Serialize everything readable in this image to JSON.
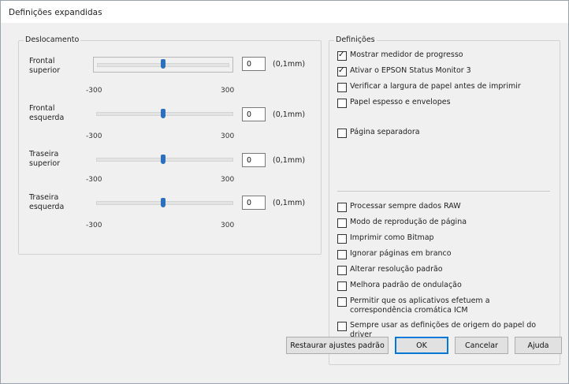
{
  "window": {
    "title": "Definições expandidas"
  },
  "offset": {
    "title": "Deslocamento",
    "unit": "(0,1mm)",
    "range_min": "-300",
    "range_max": "300",
    "sliders": [
      {
        "label": "Frontal superior",
        "value": "0",
        "slider_value": 0
      },
      {
        "label": "Frontal esquerda",
        "value": "0",
        "slider_value": 0
      },
      {
        "label": "Traseira superior",
        "value": "0",
        "slider_value": 0
      },
      {
        "label": "Traseira esquerda",
        "value": "0",
        "slider_value": 0
      }
    ]
  },
  "settings": {
    "title": "Definições",
    "options": [
      {
        "label": "Mostrar medidor de progresso",
        "checked": true
      },
      {
        "label": "Ativar o EPSON Status Monitor 3",
        "checked": true
      },
      {
        "label": "Verificar a largura de papel antes de imprimir",
        "checked": false
      },
      {
        "label": "Papel espesso e envelopes",
        "checked": false
      },
      {
        "label": "Página separadora",
        "checked": false
      },
      {
        "label": "Processar sempre dados RAW",
        "checked": false
      },
      {
        "label": "Modo de reprodução de página",
        "checked": false
      },
      {
        "label": "Imprimir como Bitmap",
        "checked": false
      },
      {
        "label": "Ignorar páginas em branco",
        "checked": false
      },
      {
        "label": "Alterar resolução padrão",
        "checked": false
      },
      {
        "label": "Melhora padrão de ondulação",
        "checked": false
      },
      {
        "label": "Permitir que os aplicativos efetuem a correspondência cromática ICM",
        "checked": false
      },
      {
        "label": "Sempre usar as definições de origem do papel do driver",
        "checked": false
      }
    ]
  },
  "buttons": {
    "restore": "Restaurar ajustes padrão",
    "ok": "OK",
    "cancel": "Cancelar",
    "help": "Ajuda"
  }
}
